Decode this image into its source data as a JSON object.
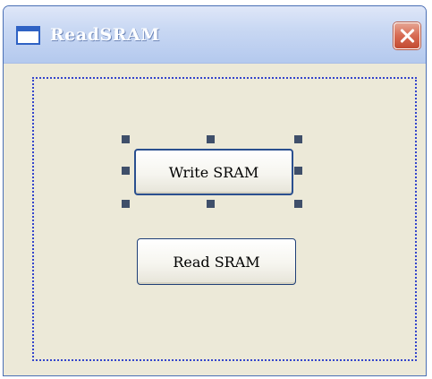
{
  "window": {
    "title": "ReadSRAM"
  },
  "buttons": {
    "write": "Write SRAM",
    "read": "Read SRAM"
  },
  "colors": {
    "form_background": "#ece9d8",
    "titlebar_start": "#dfe7f8",
    "titlebar_end": "#b4c9ee",
    "close_button": "#d76a52",
    "selection_handle": "#3f4f6a",
    "form_border": "#3344cc"
  },
  "icons": {
    "window_icon": "window-icon",
    "close": "close-icon"
  }
}
